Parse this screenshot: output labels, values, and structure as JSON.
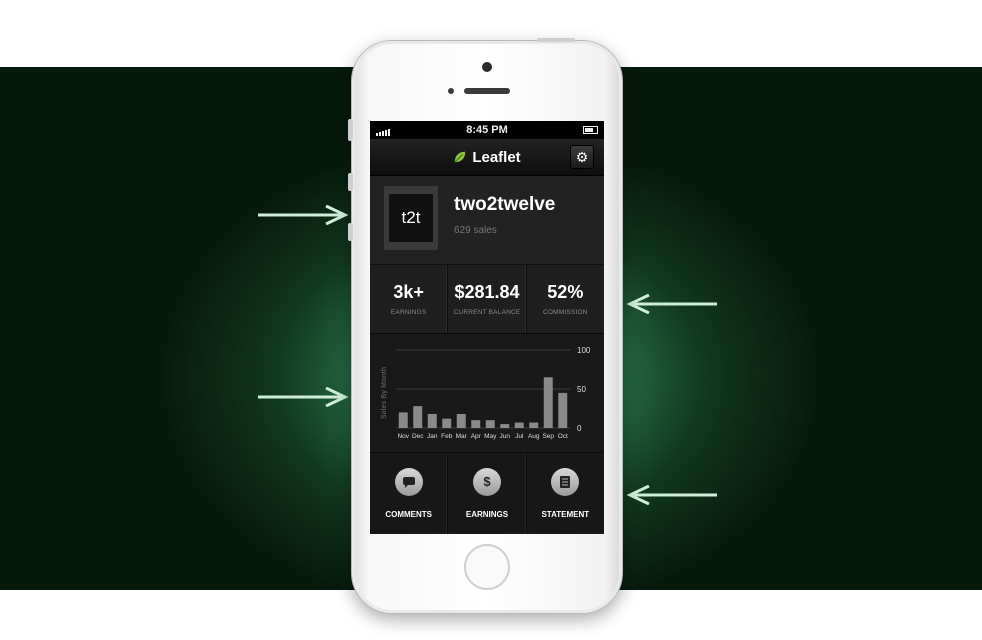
{
  "status": {
    "time": "8:45 PM"
  },
  "app": {
    "title": "Leaflet"
  },
  "profile": {
    "avatar_text": "t2t",
    "name": "two2twelve",
    "sales": "629 sales"
  },
  "stats": [
    {
      "value": "3k+",
      "label": "EARNINGS"
    },
    {
      "value": "$281.84",
      "label": "CURRENT BALANCE"
    },
    {
      "value": "52%",
      "label": "COMMISSION"
    }
  ],
  "chart_data": {
    "type": "bar",
    "ylabel": "Sales By Month",
    "categories": [
      "Nov",
      "Dec",
      "Jan",
      "Feb",
      "Mar",
      "Apr",
      "May",
      "Jun",
      "Jul",
      "Aug",
      "Sep",
      "Oct"
    ],
    "values": [
      20,
      28,
      18,
      12,
      18,
      10,
      10,
      5,
      7,
      7,
      65,
      45
    ],
    "ylim": [
      0,
      100
    ],
    "yticks": [
      "100",
      "50",
      "0"
    ],
    "grid": true
  },
  "tabs": [
    {
      "label": "COMMENTS",
      "icon": "speech-bubble-icon"
    },
    {
      "label": "EARNINGS",
      "icon": "dollar-icon"
    },
    {
      "label": "STATEMENT",
      "icon": "document-icon"
    }
  ],
  "colors": {
    "background": "#0b2a15",
    "glow": "#4fb07a",
    "arrow": "#cdeed9",
    "bar": "#8a8a8a"
  }
}
